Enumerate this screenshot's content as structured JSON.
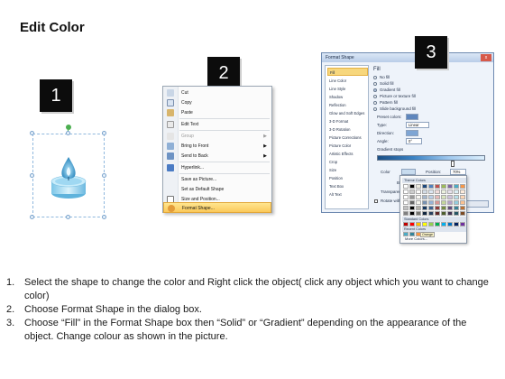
{
  "title": "Edit Color",
  "steps": [
    {
      "badge": "1"
    },
    {
      "badge": "2"
    },
    {
      "badge": "3"
    }
  ],
  "context_menu": {
    "items": [
      {
        "label": "Cut",
        "icon": "scissors-icon"
      },
      {
        "label": "Copy",
        "icon": "copy-icon"
      },
      {
        "label": "Paste",
        "icon": "paste-icon"
      },
      {
        "label": "Edit Text",
        "icon": "edit-text-icon"
      },
      {
        "label": "Group",
        "icon": "group-icon",
        "disabled": true
      },
      {
        "label": "Bring to Front",
        "icon": "bring-front-icon"
      },
      {
        "label": "Send to Back",
        "icon": "send-back-icon"
      },
      {
        "label": "Hyperlink...",
        "icon": "hyperlink-icon"
      },
      {
        "label": "Save as Picture...",
        "icon": ""
      },
      {
        "label": "Set as Default Shape",
        "icon": ""
      },
      {
        "label": "Size and Position...",
        "icon": "size-icon"
      },
      {
        "label": "Format Shape...",
        "icon": "format-shape-icon",
        "highlighted": true
      }
    ]
  },
  "format_dialog": {
    "title": "Format Shape",
    "close": "x",
    "nav": [
      "Fill",
      "Line Color",
      "Line Style",
      "Shadow",
      "Reflection",
      "Glow and Soft Edges",
      "3-D Format",
      "3-D Rotation",
      "Picture Corrections",
      "Picture Color",
      "Artistic Effects",
      "Crop",
      "Size",
      "Position",
      "Text Box",
      "Alt Text"
    ],
    "fill_heading": "Fill",
    "fill_options": [
      "No fill",
      "Solid fill",
      "Gradient fill",
      "Picture or texture fill",
      "Pattern fill",
      "Slide background fill"
    ],
    "preset_label": "Preset colors:",
    "type_label": "Type:",
    "type_value": "Linear",
    "direction_label": "Direction:",
    "angle_label": "Angle:",
    "angle_value": "0°",
    "stops_label": "Gradient stops",
    "color_label": "Color",
    "position_label": "Position:",
    "position_value": "70%",
    "brightness_label": "Brightness:",
    "transparency_label": "Transparency:",
    "rotate_label": "Rotate with shape"
  },
  "color_popup": {
    "theme_label": "Theme Colors",
    "standard_label": "Standard Colors",
    "recent_label": "Recent Colors",
    "more": "More Colors...",
    "theme_colors": [
      "#ffffff",
      "#000000",
      "#eeece1",
      "#1f497d",
      "#4f81bd",
      "#c0504d",
      "#9bbb59",
      "#8064a2",
      "#4bacc6",
      "#f79646"
    ],
    "standard_colors": [
      "#c00000",
      "#ff0000",
      "#ffc000",
      "#ffff00",
      "#92d050",
      "#00b050",
      "#00b0f0",
      "#0070c0",
      "#002060",
      "#7030a0"
    ],
    "recent_colors": [
      "#4bacc6",
      "#31849b",
      "#f79646"
    ],
    "recent_tooltip": "Orange"
  },
  "instructions": [
    {
      "num": "1.",
      "text": "Select the shape to change the color and Right click the object( click any object which you want to change color)"
    },
    {
      "num": "2.",
      "text": "Choose Format Shape in the dialog box."
    },
    {
      "num": "3.",
      "text": "Choose “Fill” in the Format Shape box then “Solid” or “Gradient” depending on the appearance of the object. Change colour as shown in the picture."
    }
  ]
}
